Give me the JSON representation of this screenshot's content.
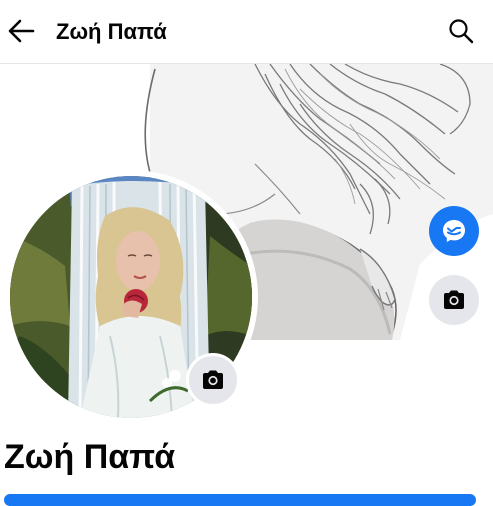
{
  "header": {
    "title": "Ζωή Παπά",
    "back_icon": "arrow-left-icon",
    "search_icon": "search-icon"
  },
  "cover": {
    "message_icon": "messenger-icon",
    "camera_icon": "camera-icon"
  },
  "profile": {
    "name": "Ζωή Παπά",
    "avatar_camera_icon": "camera-icon"
  },
  "colors": {
    "accent": "#1877f2",
    "button_grey": "#e4e6eb",
    "text": "#050505"
  }
}
